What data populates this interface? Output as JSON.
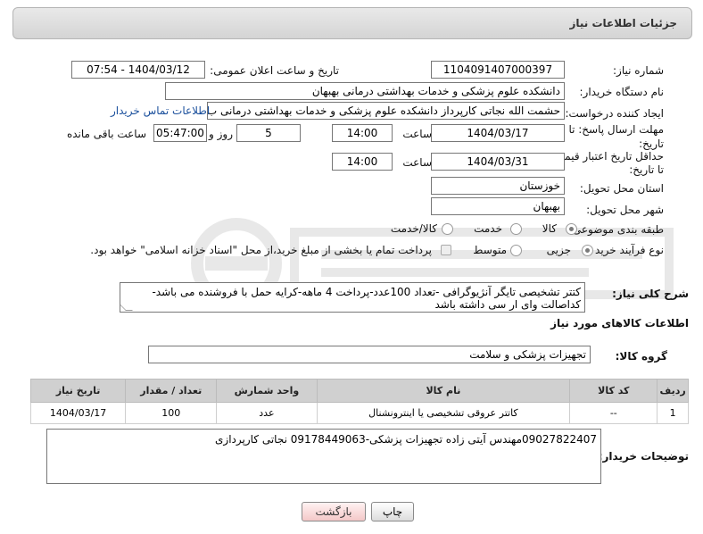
{
  "header": {
    "title": "جزئیات اطلاعات نیاز"
  },
  "fields": {
    "need_number_label": "شماره نیاز:",
    "need_number": "1104091407000397",
    "announce_label": "تاریخ و ساعت اعلان عمومی:",
    "announce_value": "1404/03/12 - 07:54",
    "buyer_label": "نام دستگاه خریدار:",
    "buyer_value": "دانشکده علوم پزشکی و خدمات بهداشتی  درمانی بهبهان",
    "creator_label": "ایجاد کننده درخواست:",
    "creator_value": "حشمت الله نجاتی کارپرداز دانشکده علوم پزشکی و خدمات بهداشتی  درمانی ب",
    "contact_link": "اطلاعات تماس خریدار",
    "deadline_label_1": "مهلت ارسال پاسخ: تا",
    "deadline_label_2": "تاریخ:",
    "deadline_date": "1404/03/17",
    "time_label": "ساعت",
    "deadline_time": "14:00",
    "days_value": "5",
    "days_label": "روز و",
    "remaining_time": "05:47:00",
    "remaining_label": "ساعت باقی مانده",
    "price_label_1": "حداقل تاریخ اعتبار قیمت:",
    "price_label_2": "تا تاریخ:",
    "price_date": "1404/03/31",
    "price_time": "14:00",
    "province_label": "استان محل تحویل:",
    "province_value": "خوزستان",
    "city_label": "شهر محل تحویل:",
    "city_value": "بهبهان",
    "category_label": "طبقه بندی موضوعی:",
    "category_options": [
      "کالا",
      "خدمت",
      "کالا/خدمت"
    ],
    "process_label": "نوع فرآیند خرید :",
    "process_options": [
      "جزیی",
      "متوسط"
    ],
    "payment_note": "پرداخت تمام یا بخشی از مبلغ خرید،از محل \"اسناد خزانه اسلامی\" خواهد بود.",
    "description_label": "شرح کلی نیاز:",
    "description_value": "کتتر تشخیصی تایگر آنژیوگرافی -تعداد 100عدد-پرداخت 4 ماهه-کرایه حمل با فروشنده می باشد-کداصالت وای ار سی داشته باشد"
  },
  "goods": {
    "section_title": "اطلاعات کالاهای مورد نیاز",
    "group_label": "گروه کالا:",
    "group_value": "تجهیزات پزشکی و سلامت",
    "columns": [
      "ردیف",
      "کد کالا",
      "نام کالا",
      "واحد شمارش",
      "تعداد / مقدار",
      "تاریخ نیاز"
    ],
    "rows": [
      [
        "1",
        "--",
        "کاتتر عروقی تشخیصی یا اینترونشنال",
        "عدد",
        "100",
        "1404/03/17"
      ]
    ]
  },
  "buyer_notes": {
    "label": "توضیحات خریدار:",
    "value": "09027822407مهندس آیتی زاده تجهیزات پزشکی-09178449063 نجاتی کارپردازی"
  },
  "buttons": {
    "print": "چاپ",
    "back": "بازگشت"
  },
  "colors": {
    "link": "#1a4f9c",
    "table_header": "#d0d0d0",
    "back_button": "#f4c8c8"
  }
}
